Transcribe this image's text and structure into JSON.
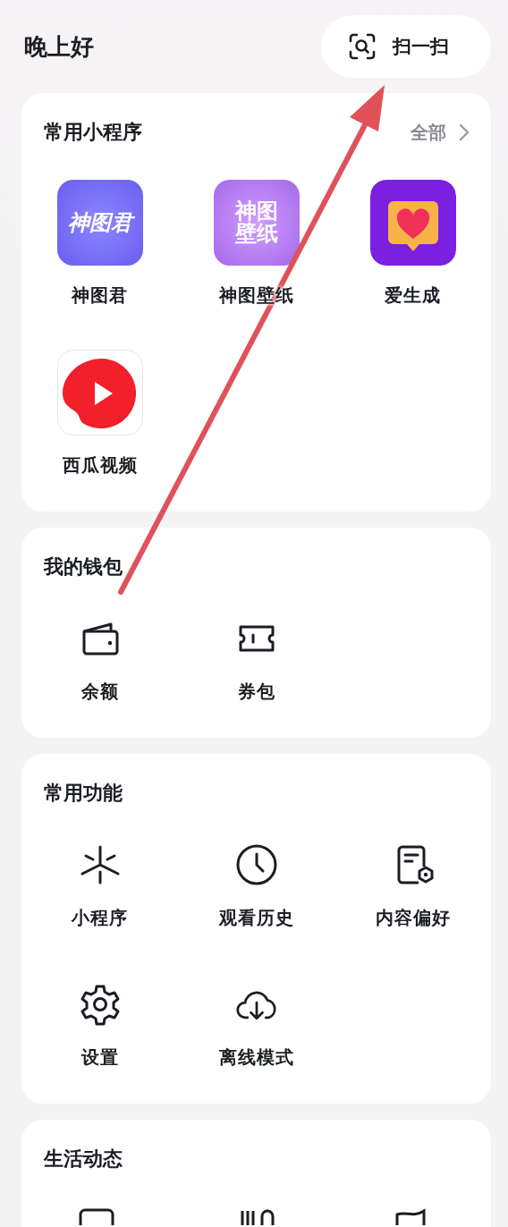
{
  "greeting": "晚上好",
  "scan_button": {
    "label": "扫一扫"
  },
  "mini_programs": {
    "title": "常用小程序",
    "more_link": "全部",
    "items": [
      {
        "label": "神图君",
        "icon_text": [
          "神图君"
        ]
      },
      {
        "label": "神图壁纸",
        "icon_text": [
          "神图",
          "壁纸"
        ]
      },
      {
        "label": "爱生成"
      },
      {
        "label": "西瓜视频"
      }
    ]
  },
  "wallet": {
    "title": "我的钱包",
    "items": [
      {
        "label": "余额"
      },
      {
        "label": "券包"
      }
    ]
  },
  "functions": {
    "title": "常用功能",
    "items": [
      {
        "label": "小程序"
      },
      {
        "label": "观看历史"
      },
      {
        "label": "内容偏好"
      },
      {
        "label": "设置"
      },
      {
        "label": "离线模式"
      }
    ]
  },
  "life": {
    "title": "生活动态"
  }
}
